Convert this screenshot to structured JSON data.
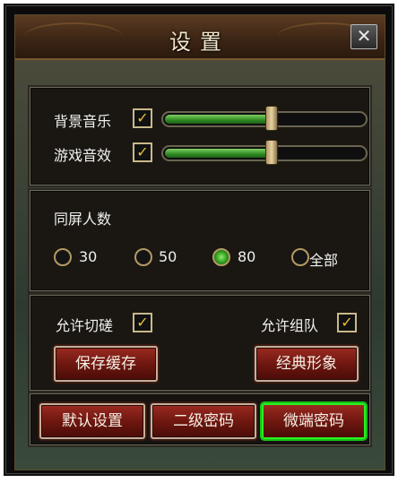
{
  "window": {
    "title": "设置",
    "close_label": "✕"
  },
  "audio": {
    "bgm": {
      "label": "背景音乐",
      "checked": true,
      "level": 0.53
    },
    "sfx": {
      "label": "游戏音效",
      "checked": true,
      "level": 0.53
    }
  },
  "screen_players": {
    "title": "同屏人数",
    "options": [
      {
        "label": "30",
        "selected": false
      },
      {
        "label": "50",
        "selected": false
      },
      {
        "label": "80",
        "selected": true
      },
      {
        "label": "全部",
        "selected": false
      }
    ]
  },
  "permissions": {
    "allow_duel": {
      "label": "允许切磋",
      "checked": true
    },
    "allow_team": {
      "label": "允许组队",
      "checked": true
    }
  },
  "actions": {
    "save_cache": "保存缓存",
    "classic_look": "经典形象",
    "default_settings": "默认设置",
    "secondary_password": "二级密码",
    "client_password": "微端密码"
  },
  "colors": {
    "slider_fill": "#2f8a22",
    "button_red": "#6b160f",
    "highlight": "#2af023"
  }
}
